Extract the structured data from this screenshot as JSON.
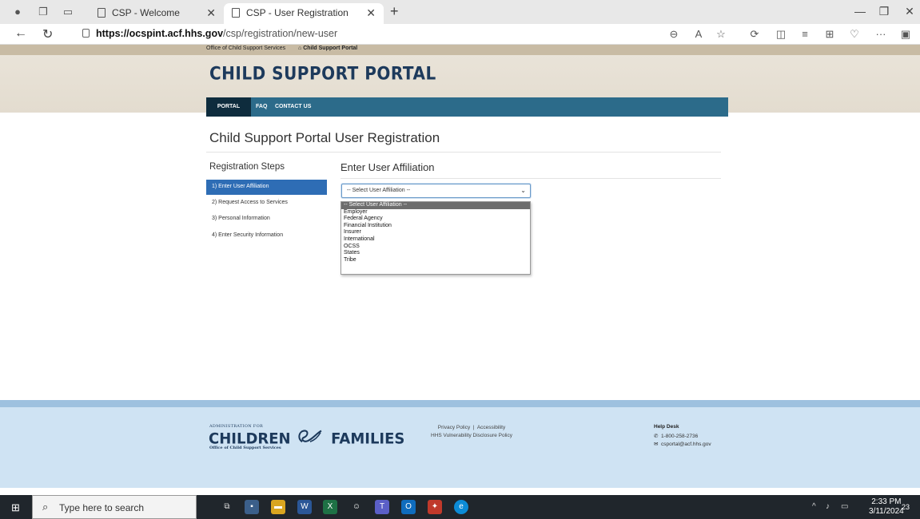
{
  "browser": {
    "tabs": [
      {
        "title": "CSP - Welcome",
        "active": false
      },
      {
        "title": "CSP - User Registration",
        "active": true
      }
    ],
    "url_host": "https://ocspint.acf.hhs.gov",
    "url_path": "/csp/registration/new-user"
  },
  "site": {
    "top_links": {
      "office": "Office of Child Support Services",
      "portal": "Child Support Portal"
    },
    "logo_title": "CHILD SUPPORT PORTAL",
    "nav": {
      "home": "PORTAL HOME",
      "faq": "FAQ",
      "contact": "CONTACT US"
    }
  },
  "main": {
    "page_title": "Child Support Portal User Registration",
    "steps_heading": "Registration Steps",
    "steps": [
      "1) Enter User Affiliation",
      "2) Request Access to Services",
      "3) Personal Information",
      "4) Enter Security Information"
    ],
    "active_step": 0,
    "affiliation_heading": "Enter User Affiliation",
    "select_value": "-- Select User Affiliation --",
    "options": [
      "-- Select User Affiliation --",
      "Employer",
      "Federal Agency",
      "Financial Institution",
      "Insurer",
      "International",
      "OCSS",
      "States",
      "Tribe"
    ]
  },
  "footer": {
    "acf_small": "ADMINISTRATION FOR",
    "acf_left": "CHILDREN",
    "acf_right": "FAMILIES",
    "acf_sub": "Office of Child Support Services",
    "privacy": "Privacy Policy",
    "accessibility": "Accessibility",
    "vuln": "HHS Vulnerability Disclosure Policy",
    "help_heading": "Help Desk",
    "phone": "1-800-258-2736",
    "email": "csportal@acf.hhs.gov"
  },
  "taskbar": {
    "search_placeholder": "Type here to search",
    "time": "2:33 PM",
    "date": "3/11/2024",
    "notifications": "23"
  }
}
